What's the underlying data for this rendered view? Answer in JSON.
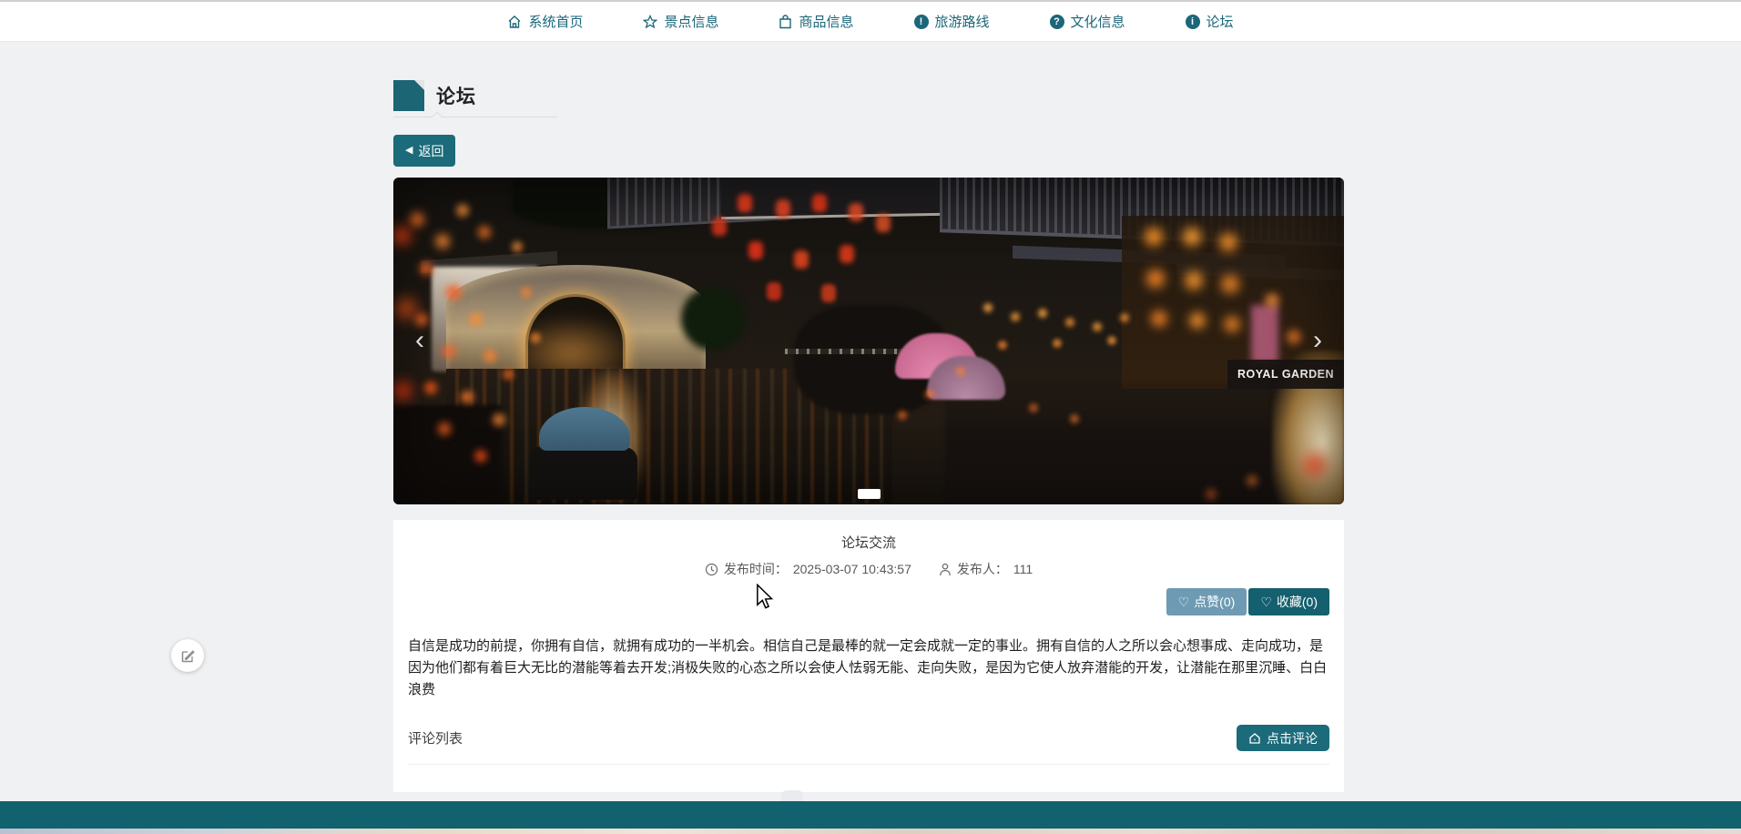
{
  "nav": {
    "items": [
      {
        "label": "系统首页",
        "icon": "home"
      },
      {
        "label": "景点信息",
        "icon": "star"
      },
      {
        "label": "商品信息",
        "icon": "bag"
      },
      {
        "label": "旅游路线",
        "badge": "!"
      },
      {
        "label": "文化信息",
        "badge": "?"
      },
      {
        "label": "论坛",
        "badge": "i"
      }
    ]
  },
  "page": {
    "title": "论坛",
    "back_label": "返回"
  },
  "icons": {
    "back_arrow": "◀",
    "heart": "♡",
    "prev": "‹",
    "next": "›"
  },
  "carousel": {
    "sign_text": "ROYAL GARDEN"
  },
  "post": {
    "title": "论坛交流",
    "publish_time_label": "发布时间：",
    "publish_time": "2025-03-07 10:43:57",
    "publisher_label": "发布人：",
    "publisher": "111",
    "like_label": "点赞(0)",
    "favorite_label": "收藏(0)",
    "content": "自信是成功的前提，你拥有自信，就拥有成功的一半机会。相信自己是最棒的就一定会成就一定的事业。拥有自信的人之所以会心想事成、走向成功，是因为他们都有着巨大无比的潜能等着去开发;消极失败的心态之所以会使人怯弱无能、走向失败，是因为它使人放弃潜能的开发，让潜能在那里沉睡、白白浪费",
    "comments_label": "评论列表",
    "comment_button_label": "点击评论"
  },
  "colors": {
    "accent_teal": "#1b6b7a",
    "like_blue": "#6e9bb3",
    "favorite_teal": "#14606f",
    "footer_teal": "#11616e",
    "page_bg": "#f0f1f2"
  }
}
